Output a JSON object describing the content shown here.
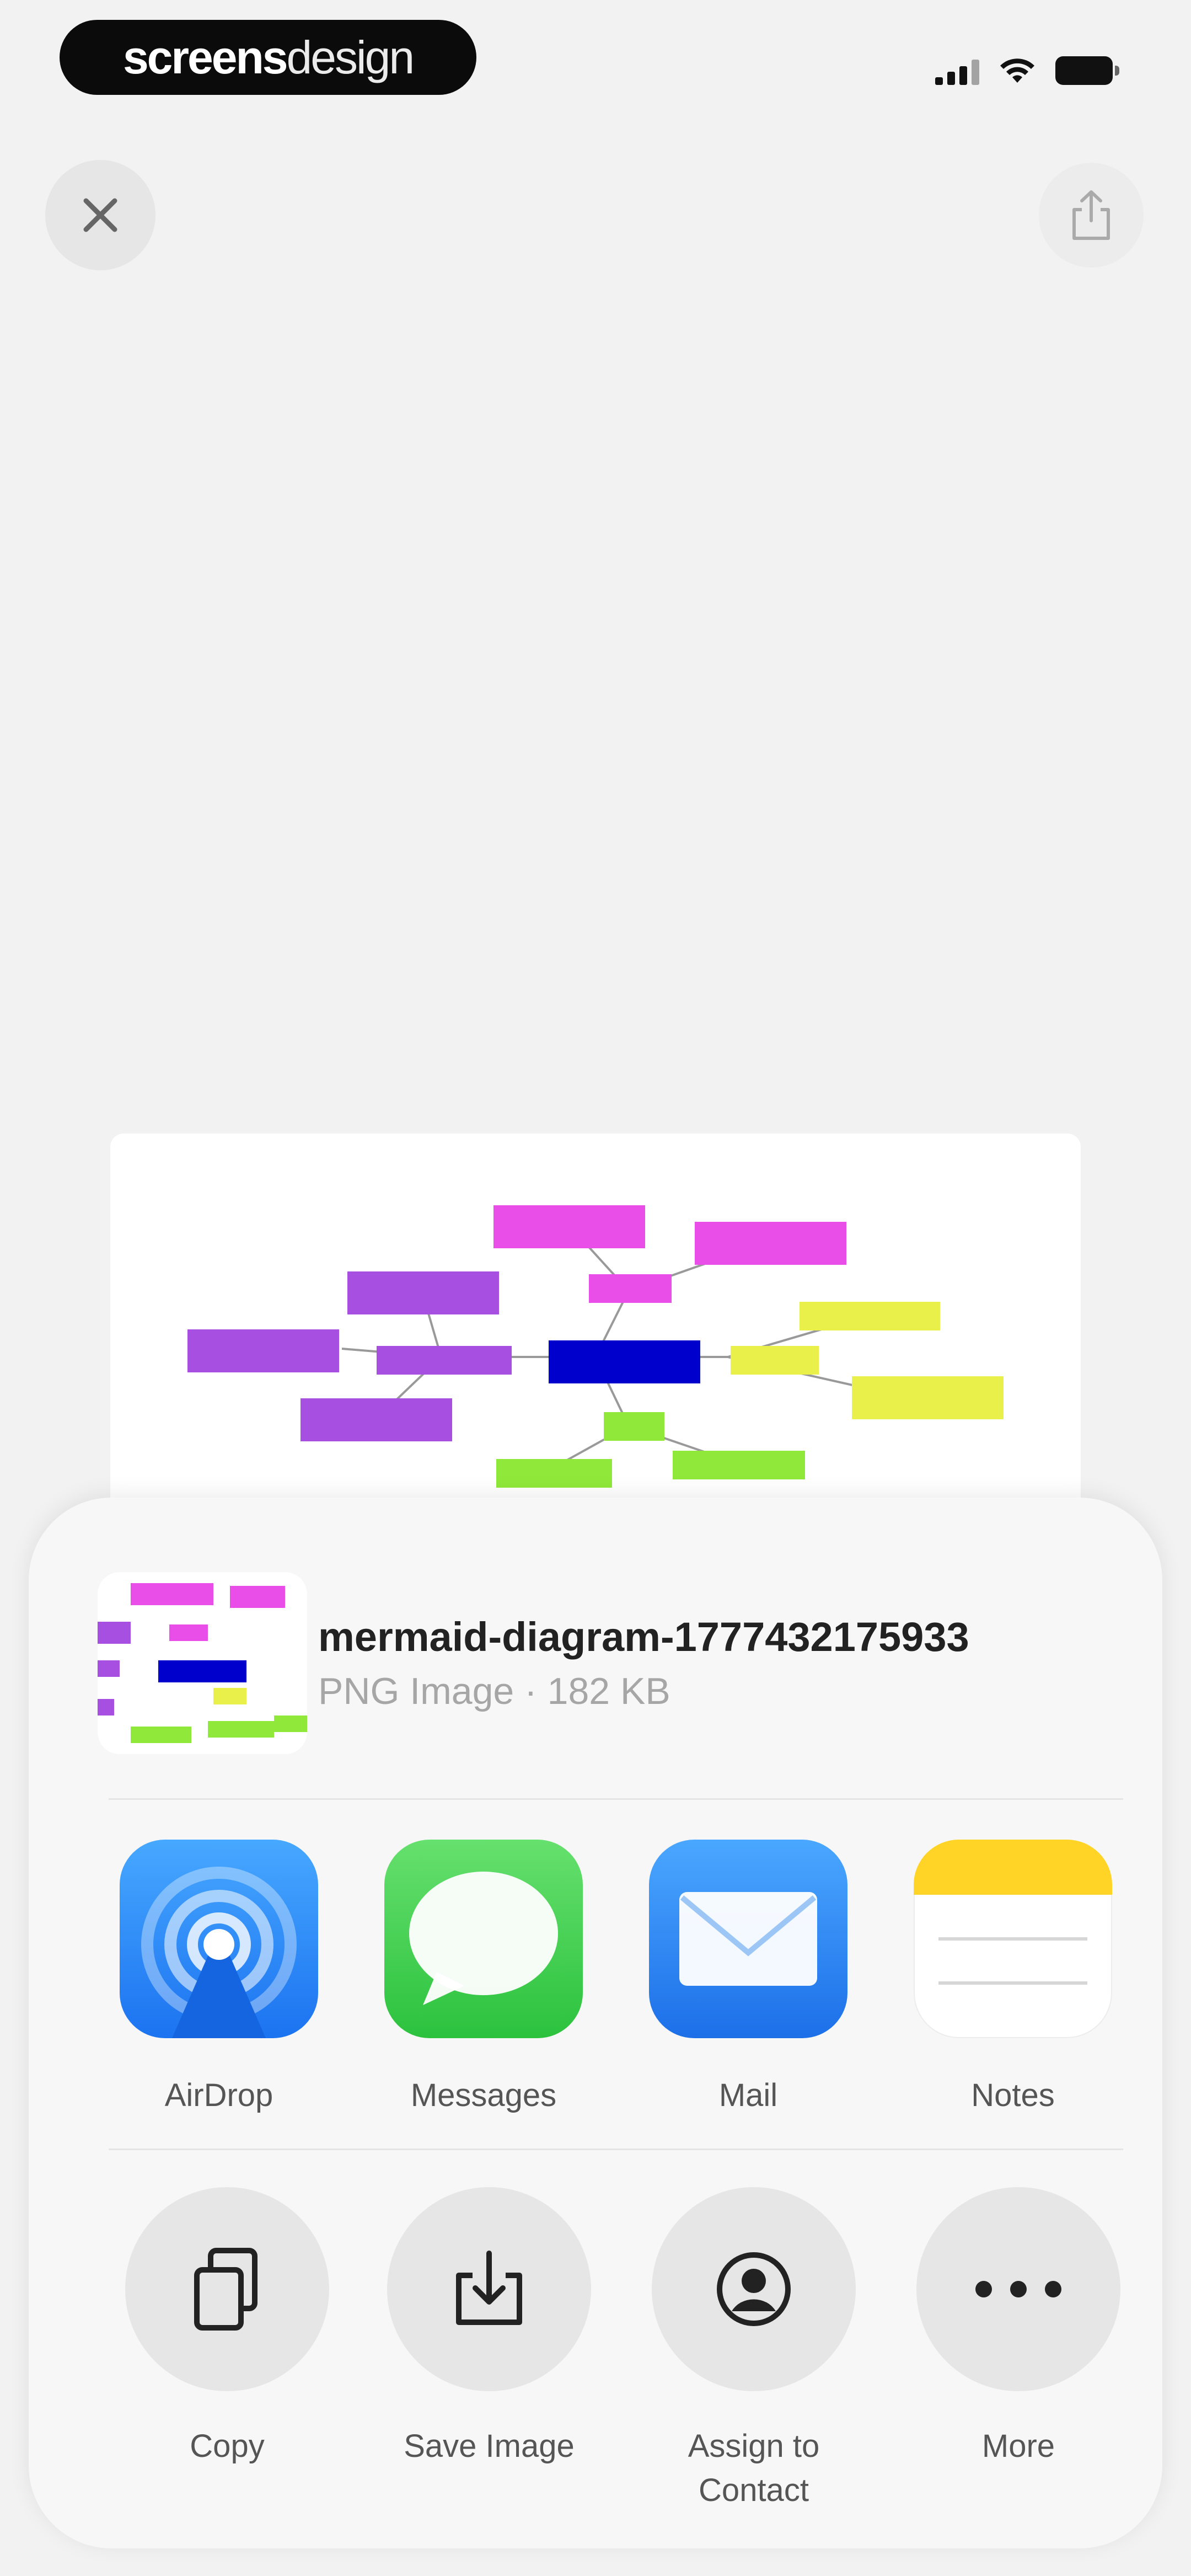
{
  "status_bar": {
    "brand_bold": "screens",
    "brand_light": "design"
  },
  "top_bar": {
    "close_icon": "close-x-icon",
    "share_icon": "share-upload-icon"
  },
  "preview": {
    "diagram_colors": [
      "#e94ee8",
      "#a64fe0",
      "#0000cc",
      "#e9f04a",
      "#8fe83a"
    ]
  },
  "share_sheet": {
    "file_name": "mermaid-diagram-1777432175933",
    "file_meta": "PNG Image · 182 KB",
    "apps": [
      {
        "label": "AirDrop",
        "icon": "airdrop-icon"
      },
      {
        "label": "Messages",
        "icon": "messages-icon"
      },
      {
        "label": "Mail",
        "icon": "mail-icon"
      },
      {
        "label": "Notes",
        "icon": "notes-icon"
      }
    ],
    "actions": [
      {
        "label": "Copy",
        "icon": "copy-icon"
      },
      {
        "label": "Save Image",
        "icon": "save-image-icon"
      },
      {
        "label": "Assign to Contact",
        "icon": "contact-icon"
      },
      {
        "label": "More",
        "icon": "more-ellipsis-icon"
      }
    ]
  }
}
